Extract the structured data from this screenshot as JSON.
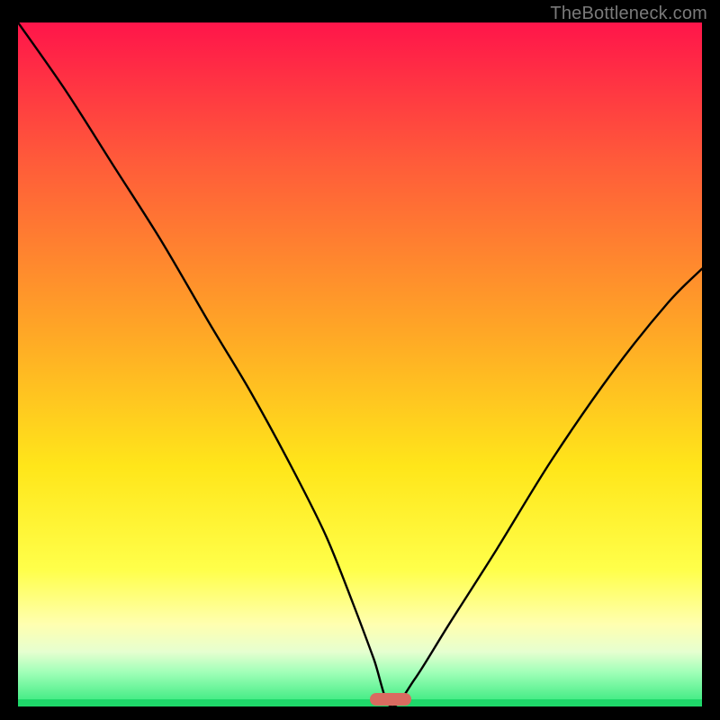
{
  "watermark": {
    "text": "TheBottleneck.com"
  },
  "chart_data": {
    "type": "line",
    "title": "",
    "xlabel": "",
    "ylabel": "",
    "xlim": [
      0,
      1
    ],
    "ylim": [
      0,
      1
    ],
    "grid": false,
    "legend": false,
    "background_gradient": [
      "#ff154a",
      "#ffe61a",
      "#30e87a"
    ],
    "marker": {
      "x": 0.545,
      "color": "#d96b60"
    },
    "series": [
      {
        "name": "bottleneck-curve",
        "color": "#000000",
        "x": [
          0.0,
          0.07,
          0.14,
          0.21,
          0.28,
          0.34,
          0.4,
          0.45,
          0.49,
          0.52,
          0.545,
          0.58,
          0.63,
          0.7,
          0.78,
          0.87,
          0.95,
          1.0
        ],
        "y": [
          1.0,
          0.9,
          0.79,
          0.68,
          0.56,
          0.46,
          0.35,
          0.25,
          0.15,
          0.07,
          0.0,
          0.04,
          0.12,
          0.23,
          0.36,
          0.49,
          0.59,
          0.64
        ]
      }
    ]
  }
}
